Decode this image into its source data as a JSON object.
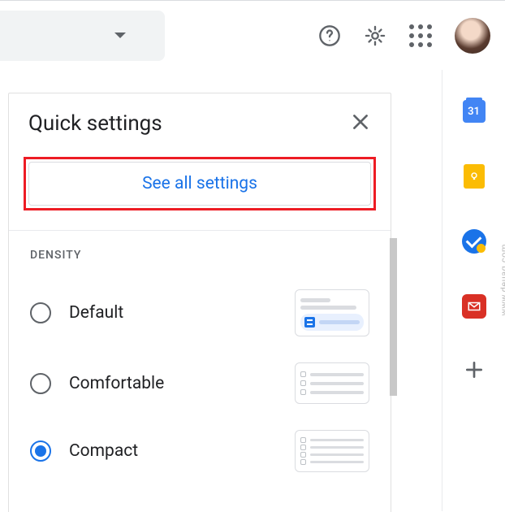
{
  "header": {
    "dropdown_label": ""
  },
  "panel": {
    "title": "Quick settings",
    "see_all_label": "See all settings"
  },
  "density": {
    "section_label": "DENSITY",
    "options": [
      {
        "label": "Default",
        "selected": false
      },
      {
        "label": "Comfortable",
        "selected": false
      },
      {
        "label": "Compact",
        "selected": true
      }
    ]
  },
  "side_rail": {
    "calendar_day": "31"
  },
  "watermark": "www.deuaq.com"
}
